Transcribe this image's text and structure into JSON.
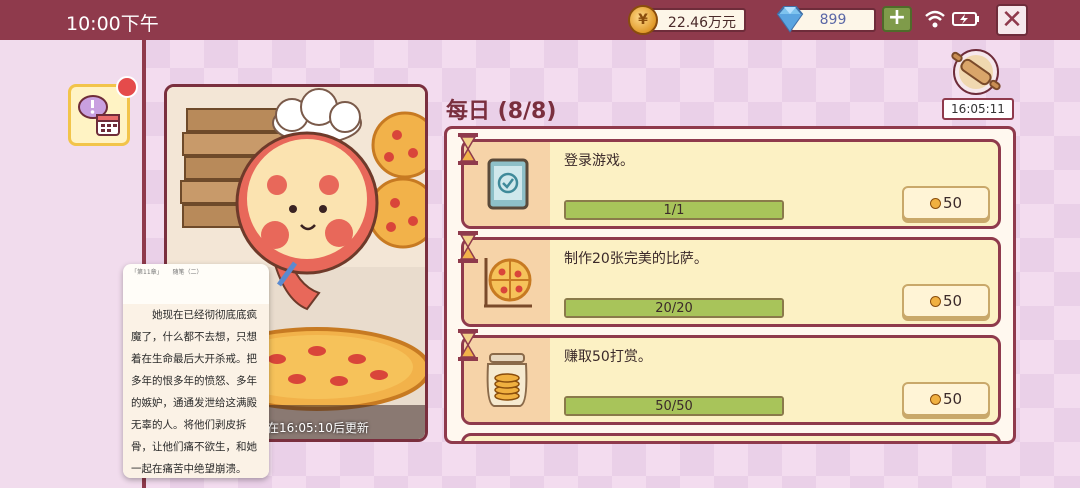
{
  "status_bar": {
    "time": "10:00下午"
  },
  "currency": {
    "coins": "22.46万元",
    "gems": "899",
    "plus_label": "+",
    "close_label": "✕"
  },
  "colors": {
    "top_bar": "#8f3a4c",
    "accent_green": "#a8c45a",
    "panel_cream": "#fcf1c4"
  },
  "icons": {
    "coin": "coin-icon",
    "gem": "diamond-icon",
    "wifi": "wifi-icon",
    "battery": "battery-icon",
    "event": "event-calendar-icon",
    "timer": "rolling-pin-icon",
    "hourglass": "hourglass-icon"
  },
  "picture_panel": {
    "caption": "在16:05:10后更新"
  },
  "reader_overlay": {
    "header": "「第11章」 　 随笔（二）",
    "paragraph": "她现在已经彻彻底底疯魔了，什么都不去想，只想着在生命最后大开杀戒。把多年的恨多年的愤怒、多年的嫉妒，通通发泄给这满殿无辜的人。将他们剥皮拆骨，让他们痛不欲生，和她一起在痛苦中绝望崩溃。"
  },
  "daily": {
    "title": "每日 (8/8)",
    "timer": "16:05:11",
    "tasks": [
      {
        "label": "登录游戏。",
        "progress": "1/1",
        "progress_fraction": 1.0,
        "reward": "50"
      },
      {
        "label": "制作20张完美的比萨。",
        "progress": "20/20",
        "progress_fraction": 1.0,
        "reward": "50"
      },
      {
        "label": "赚取50打赏。",
        "progress": "50/50",
        "progress_fraction": 1.0,
        "reward": "50"
      }
    ]
  }
}
